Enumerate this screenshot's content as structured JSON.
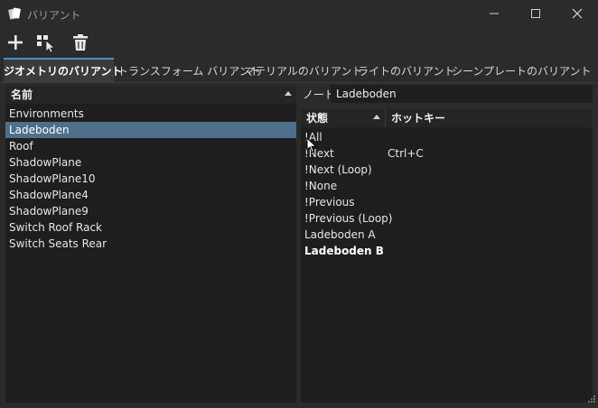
{
  "window": {
    "title": "バリアント"
  },
  "tabs": [
    {
      "label": "ジオメトリのバリアント",
      "active": true
    },
    {
      "label": "トランスフォーム バリアント",
      "active": false
    },
    {
      "label": "マテリアルのバリアント",
      "active": false
    },
    {
      "label": "ライトのバリアント",
      "active": false
    },
    {
      "label": "シーンプレートのバリアント",
      "active": false
    }
  ],
  "left_list": {
    "header": "名前",
    "items": [
      {
        "label": "Environments",
        "selected": false
      },
      {
        "label": "Ladeboden",
        "selected": true
      },
      {
        "label": "Roof",
        "selected": false
      },
      {
        "label": "ShadowPlane",
        "selected": false
      },
      {
        "label": "ShadowPlane10",
        "selected": false
      },
      {
        "label": "ShadowPlane4",
        "selected": false
      },
      {
        "label": "ShadowPlane9",
        "selected": false
      },
      {
        "label": "Switch Roof Rack",
        "selected": false
      },
      {
        "label": "Switch Seats Rear",
        "selected": false
      }
    ]
  },
  "node": {
    "label": "ノード",
    "value": "Ladeboden"
  },
  "states_table": {
    "columns": [
      "状態",
      "ホットキー"
    ],
    "rows": [
      {
        "state": "!All",
        "hotkey": "",
        "bold": false
      },
      {
        "state": "!Next",
        "hotkey": "Ctrl+C",
        "bold": false
      },
      {
        "state": "!Next (Loop)",
        "hotkey": "",
        "bold": false
      },
      {
        "state": "!None",
        "hotkey": "",
        "bold": false
      },
      {
        "state": "!Previous",
        "hotkey": "",
        "bold": false
      },
      {
        "state": "!Previous (Loop)",
        "hotkey": "",
        "bold": false
      },
      {
        "state": "Ladeboden A",
        "hotkey": "",
        "bold": false
      },
      {
        "state": "Ladeboden B",
        "hotkey": "",
        "bold": true
      }
    ]
  },
  "colors": {
    "accent": "#4a90c8",
    "selection": "#4d6f8c",
    "panel_bg": "#1e1e1e",
    "window_bg": "#2b2b2b"
  }
}
